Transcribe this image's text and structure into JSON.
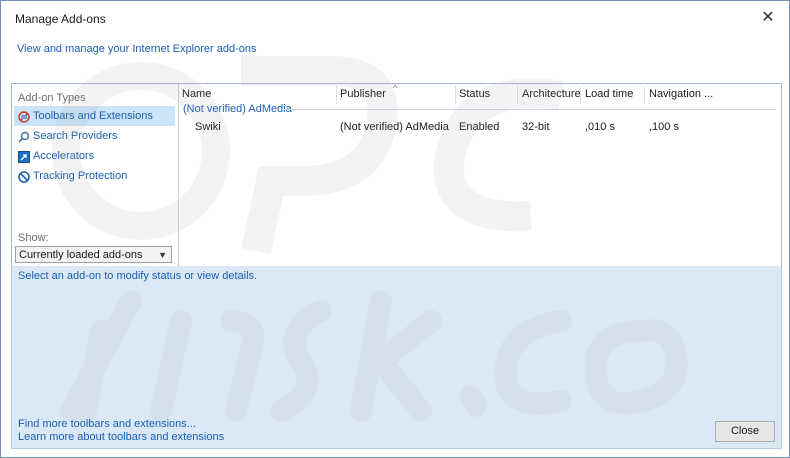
{
  "window": {
    "title": "Manage Add-ons",
    "close_glyph": "✕",
    "subtitle": "View and manage your Internet Explorer add-ons"
  },
  "sidebar": {
    "heading": "Add-on Types",
    "items": [
      {
        "label": "Toolbars and Extensions",
        "icon": "toolbar-extensions-icon",
        "selected": true
      },
      {
        "label": "Search Providers",
        "icon": "search-icon",
        "selected": false
      },
      {
        "label": "Accelerators",
        "icon": "accelerator-icon",
        "selected": false
      },
      {
        "label": "Tracking Protection",
        "icon": "block-icon",
        "selected": false
      }
    ],
    "show_label": "Show:",
    "show_value": "Currently loaded add-ons"
  },
  "list": {
    "columns": [
      "Name",
      "Publisher",
      "Status",
      "Architecture",
      "Load time",
      "Navigation ..."
    ],
    "group": "(Not verified) AdMedia",
    "rows": [
      {
        "name": "Swiki",
        "publisher": "(Not verified) AdMedia",
        "status": "Enabled",
        "architecture": "32-bit",
        "load_time": ",010 s",
        "navigation": ",100 s"
      }
    ]
  },
  "details": {
    "message": "Select an add-on to modify status or view details.",
    "link_find": "Find more toolbars and extensions...",
    "link_learn": "Learn more about toolbars and extensions",
    "close_label": "Close"
  },
  "colors": {
    "link": "#1a5fb4",
    "selection": "#cce4f7",
    "details_bg": "#dbe8f5"
  }
}
